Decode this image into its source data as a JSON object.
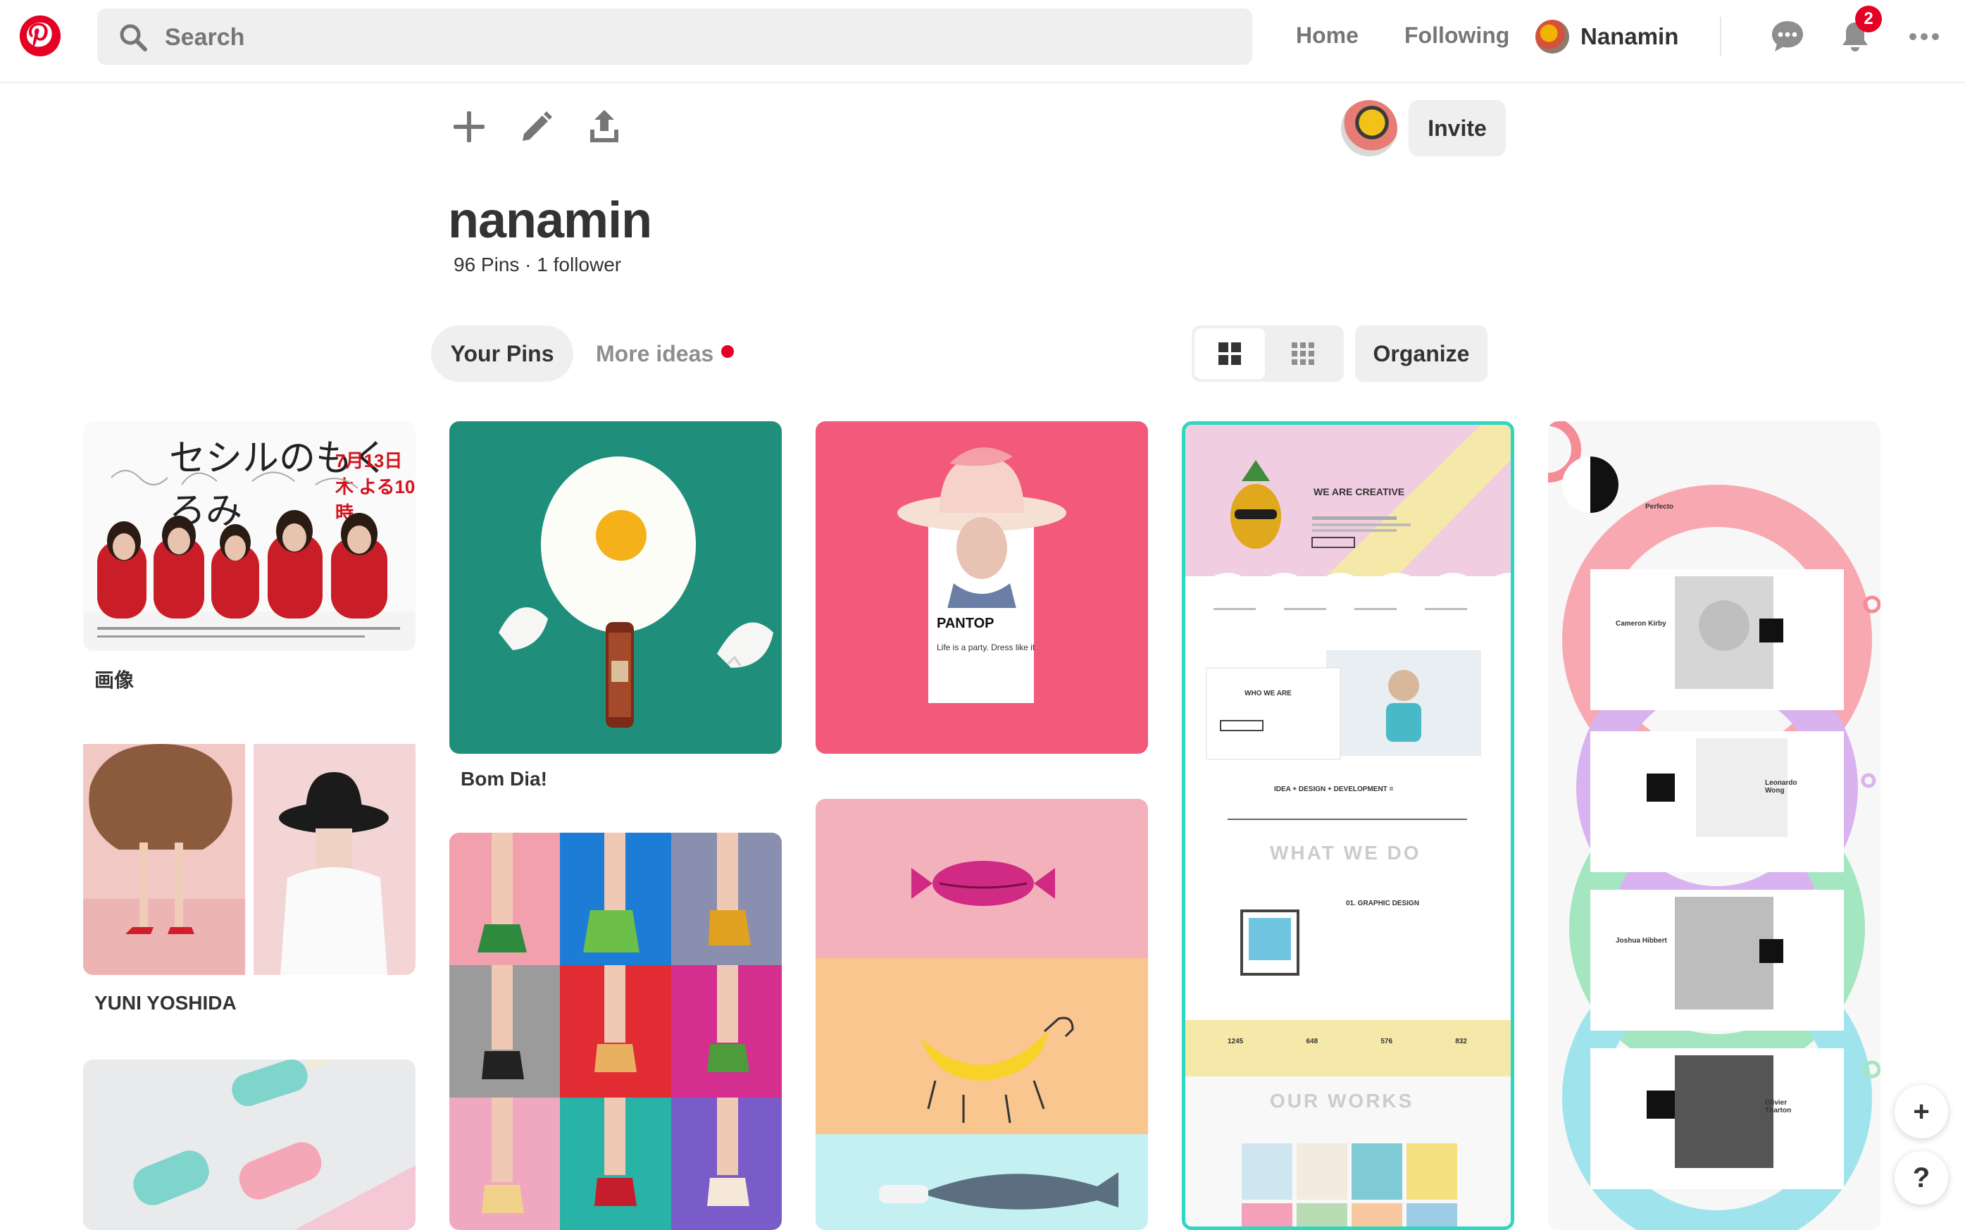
{
  "header": {
    "search_placeholder": "Search",
    "nav_home": "Home",
    "nav_following": "Following",
    "profile_name": "Nanamin",
    "notification_count": "2"
  },
  "board": {
    "collaborator_invite_label": "Invite",
    "title": "nanamin",
    "meta": "96 Pins · 1 follower",
    "tab_your_pins": "Your Pins",
    "tab_more_ideas": "More ideas",
    "organize_label": "Organize"
  },
  "pins": [
    {
      "caption": "画像",
      "poster_title": "セシルのもくろみ",
      "poster_date": "7月13日木 よる10時"
    },
    {
      "caption": "Bom Dia!"
    },
    {
      "caption": "",
      "card_title": "PANTOP",
      "card_sub": "Life is a party. Dress like it"
    },
    {
      "caption": "",
      "hero": "WE ARE CREATIVE",
      "who": "WHO WE ARE",
      "tagline": "IDEA + DESIGN + DEVELOPMENT =",
      "what": "WHAT WE DO",
      "graphic": "01. GRAPHIC DESIGN",
      "works": "OUR WORKS",
      "stats": [
        "1245",
        "648",
        "576",
        "832"
      ]
    },
    {
      "caption": "",
      "brand": "Perfecto",
      "people": [
        "Cameron Kirby",
        "Leonardo Wong",
        "Joshua Hibbert",
        "Olivier Tharton"
      ]
    },
    {
      "caption": "YUNI YOSHIDA"
    },
    {
      "caption": ""
    },
    {
      "caption": ""
    },
    {
      "caption": ""
    }
  ],
  "fab": {
    "add": "+",
    "help": "?"
  },
  "colors": {
    "brand": "#e60023",
    "selected_border": "#2fd6c2"
  },
  "icons": {
    "add": "plus-icon",
    "edit": "pencil-icon",
    "share": "share-icon",
    "chat": "chat-icon",
    "notifications": "bell-icon",
    "more": "more-icon"
  }
}
